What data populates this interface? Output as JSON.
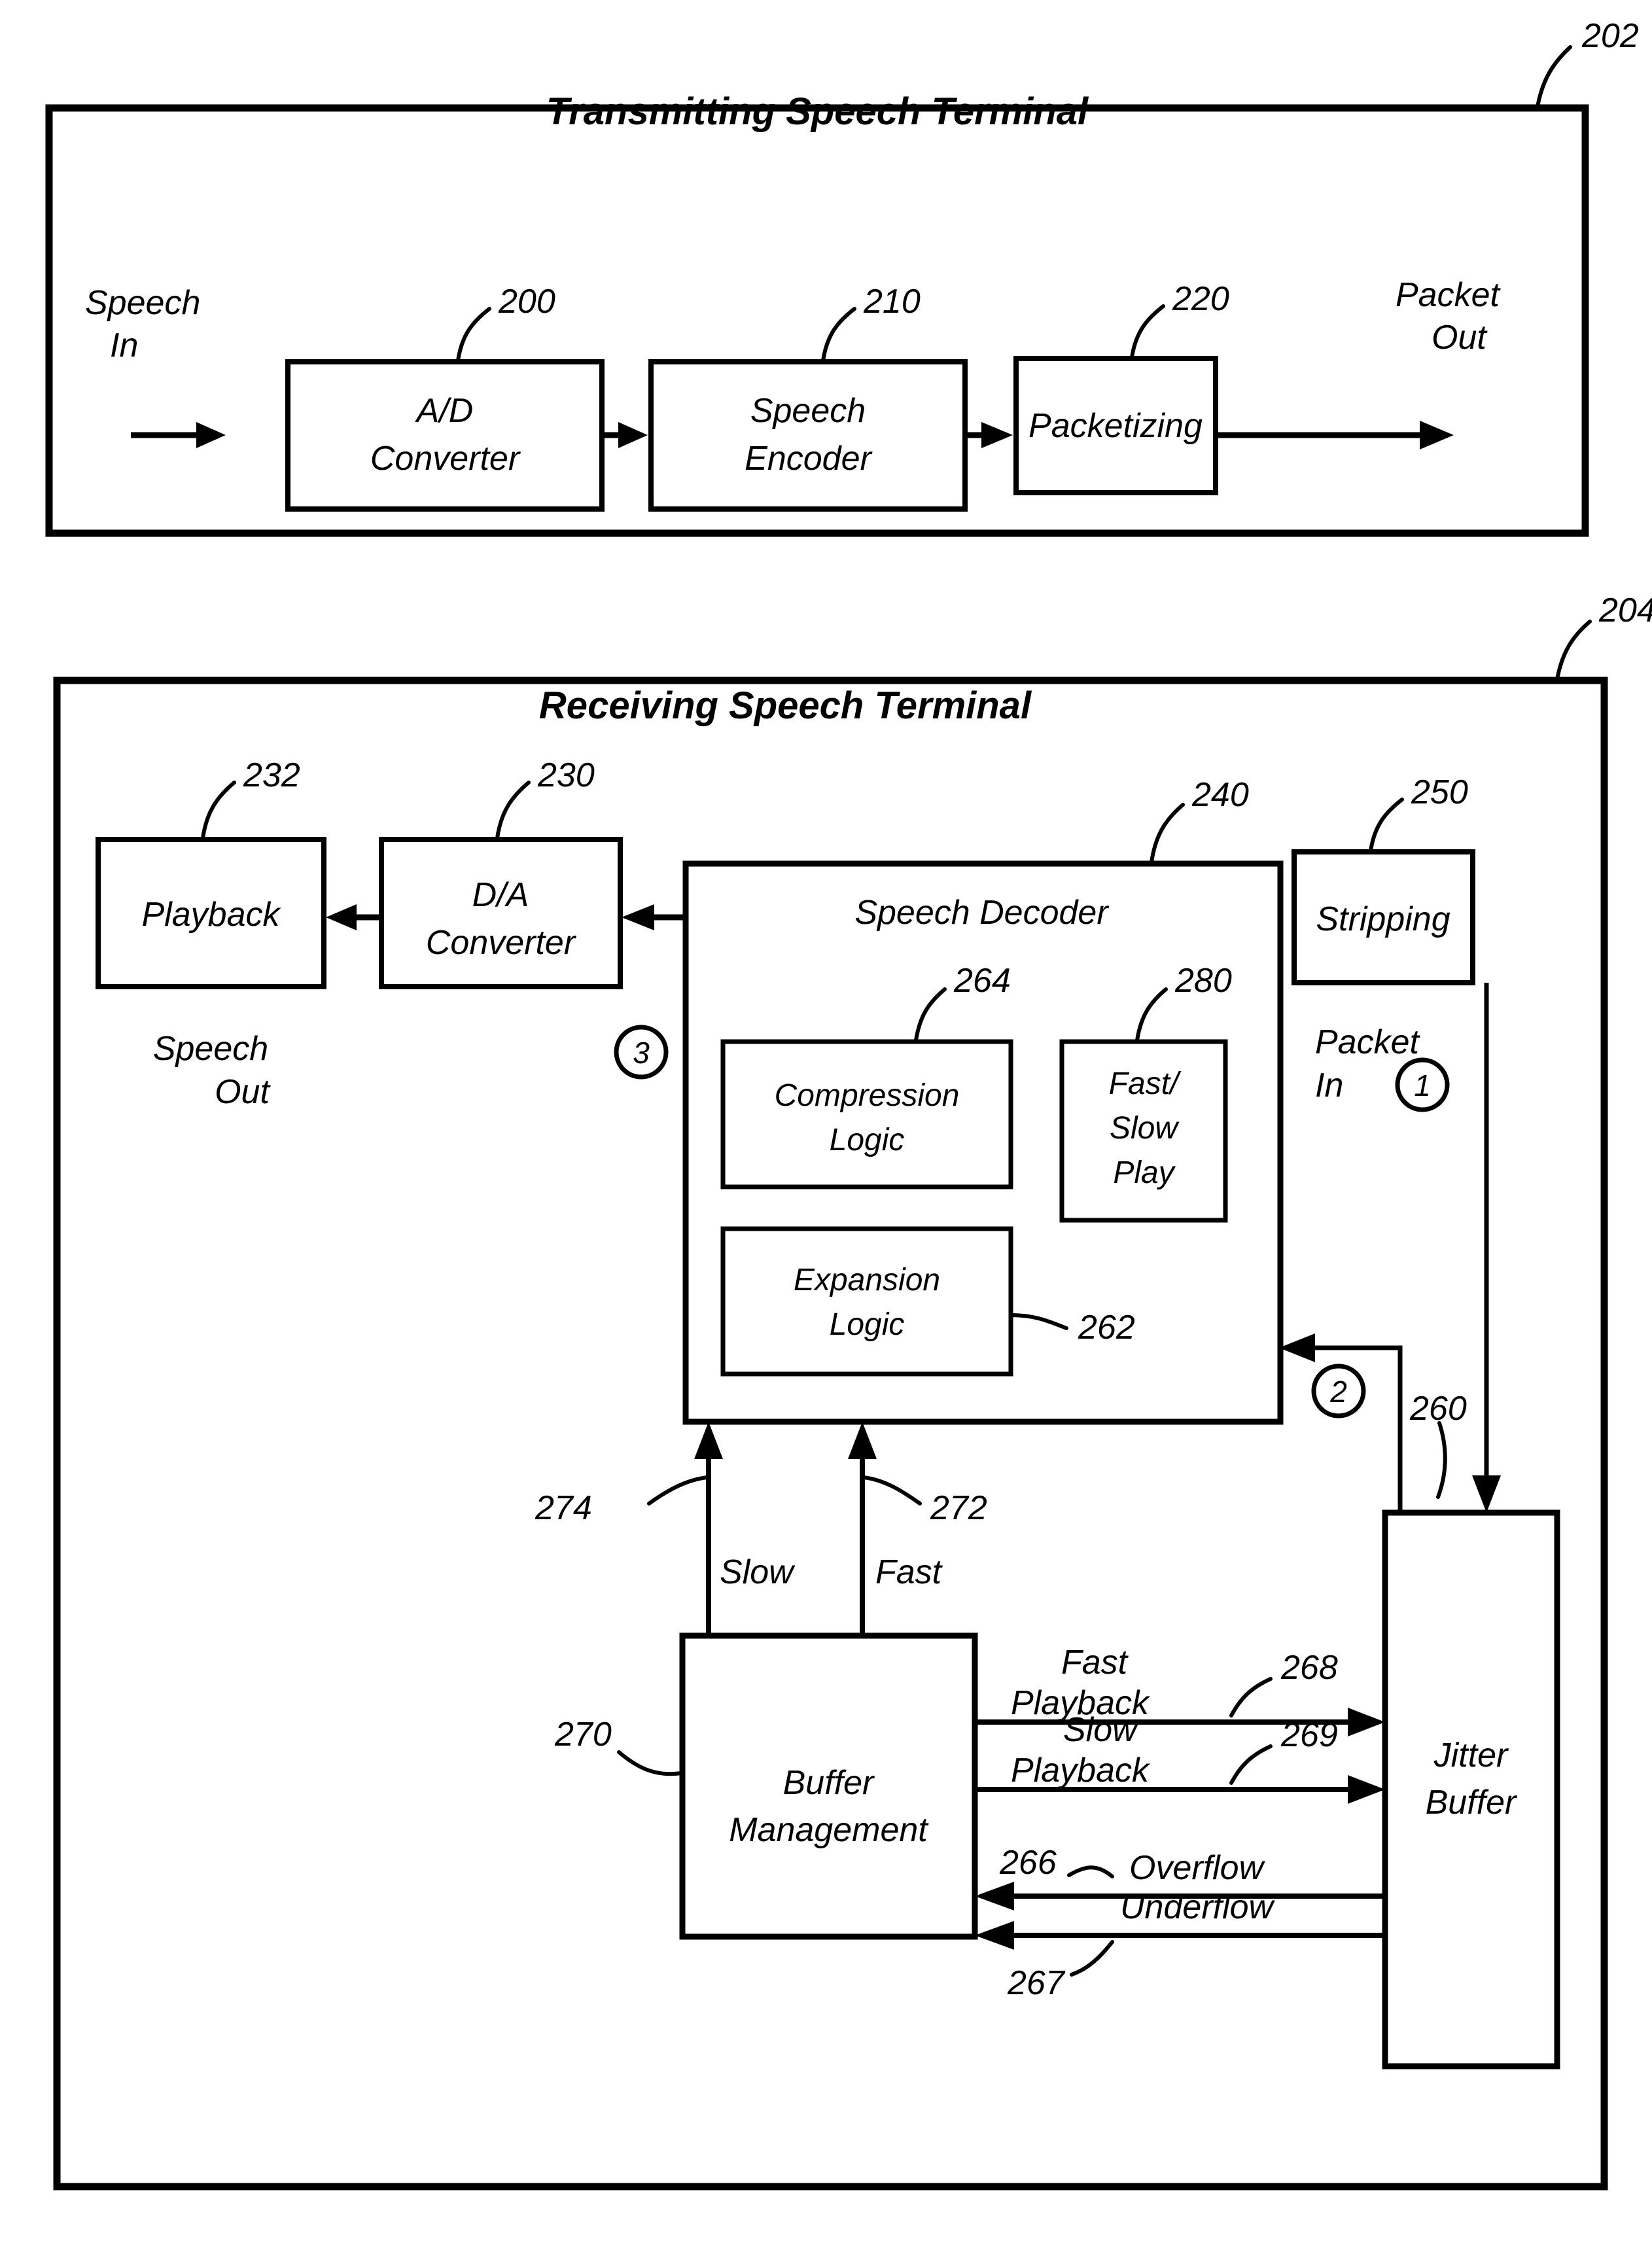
{
  "figure": {
    "type": "patent-block-diagram",
    "terminals": [
      {
        "ref": "202",
        "title": "Transmitting Speech Terminal",
        "input_label_line1": "Speech",
        "input_label_line2": "In",
        "output_label_line1": "Packet",
        "output_label_line2": "Out",
        "blocks": [
          {
            "ref": "200",
            "line1": "A/D",
            "line2": "Converter"
          },
          {
            "ref": "210",
            "line1": "Speech",
            "line2": "Encoder"
          },
          {
            "ref": "220",
            "line1": "Packetizing",
            "line2": ""
          }
        ]
      },
      {
        "ref": "204",
        "title": "Receiving Speech Terminal",
        "blocks": [
          {
            "ref": "232",
            "line1": "Playback",
            "line2": ""
          },
          {
            "ref": "230",
            "line1": "D/A",
            "line2": "Converter"
          },
          {
            "ref": "240",
            "line1": "Speech Decoder",
            "line2": ""
          },
          {
            "ref": "250",
            "line1": "Stripping",
            "line2": ""
          },
          {
            "ref": "264",
            "line1": "Compression",
            "line2": "Logic"
          },
          {
            "ref": "280",
            "line1": "Fast/",
            "line2": "Slow",
            "line3": "Play"
          },
          {
            "ref": "262",
            "line1": "Expansion",
            "line2": "Logic"
          },
          {
            "ref": "270",
            "line1": "Buffer",
            "line2": "Management"
          },
          {
            "ref": "260",
            "line1": "Jitter",
            "line2": "Buffer"
          }
        ],
        "speech_out_line1": "Speech",
        "speech_out_line2": "Out",
        "packet_in_line1": "Packet",
        "packet_in_line2": "In",
        "signals": [
          {
            "ref": "274",
            "label": "Slow"
          },
          {
            "ref": "272",
            "label": "Fast"
          },
          {
            "ref": "268",
            "label_line1": "Fast",
            "label_line2": "Playback"
          },
          {
            "ref": "269",
            "label_line1": "Slow",
            "label_line2": "Playback"
          },
          {
            "ref": "266",
            "label": "Overflow"
          },
          {
            "ref": "267",
            "label": "Underflow"
          }
        ],
        "step_markers": [
          "1",
          "2",
          "3"
        ]
      }
    ],
    "colors": {
      "ink": "#000000",
      "paper": "#ffffff"
    }
  }
}
